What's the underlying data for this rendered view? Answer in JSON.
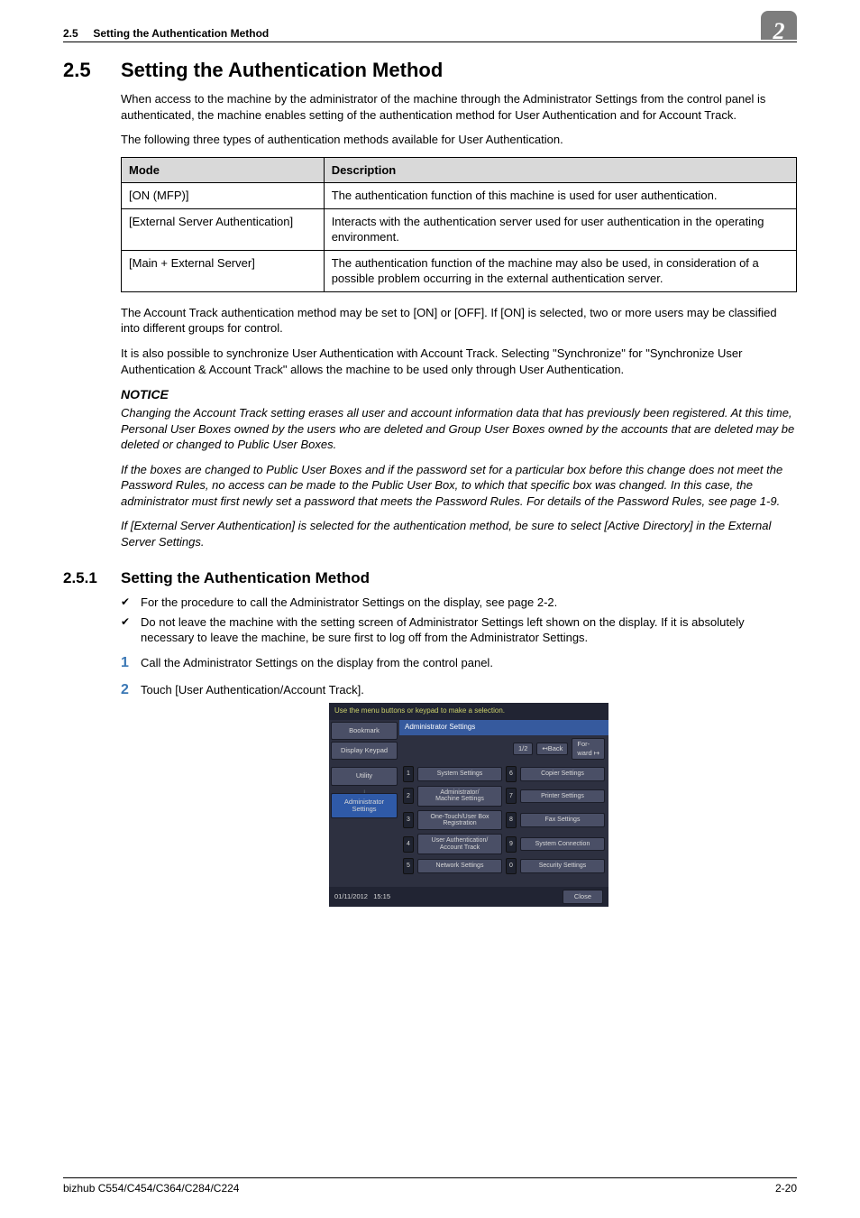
{
  "chapter_number": "2",
  "running_head": {
    "section_no": "2.5",
    "title": "Setting the Authentication Method"
  },
  "h1": {
    "number": "2.5",
    "title": "Setting the Authentication Method"
  },
  "intro": {
    "p1": "When access to the machine by the administrator of the machine through the Administrator Settings from the control panel is authenticated, the machine enables setting of the authentication method for User Authentication and for Account Track.",
    "p2": "The following three types of authentication methods available for User Authentication."
  },
  "table": {
    "head": {
      "c1": "Mode",
      "c2": "Description"
    },
    "rows": [
      {
        "c1": "[ON (MFP)]",
        "c2": "The authentication function of this machine is used for user authentication."
      },
      {
        "c1": "[External Server Authentication]",
        "c2": "Interacts with the authentication server used for user authentication in the operating environment."
      },
      {
        "c1": "[Main + External Server]",
        "c2": "The authentication function of the machine may also be used, in consideration of a possible problem occurring in the external authentication server."
      }
    ]
  },
  "after_table": {
    "p1": "The Account Track authentication method may be set to [ON] or [OFF]. If [ON] is selected, two or more users may be classified into different groups for control.",
    "p2": "It is also possible to synchronize User Authentication with Account Track. Selecting \"Synchronize\" for \"Synchronize User Authentication & Account Track\" allows the machine to be used only through User Authentication."
  },
  "notice": {
    "label": "NOTICE",
    "p1": "Changing the Account Track setting erases all user and account information data that has previously been registered. At this time, Personal User Boxes owned by the users who are deleted and Group User Boxes owned by the accounts that are deleted may be deleted or changed to Public User Boxes.",
    "p2": "If the boxes are changed to Public User Boxes and if the password set for a particular box before this change does not meet the Password Rules, no access can be made to the Public User Box, to which that specific box was changed. In this case, the administrator must first newly set a password that meets the Password Rules. For details of the Password Rules, see page 1-9.",
    "p3": "If [External Server Authentication] is selected for the authentication method, be sure to select [Active Directory] in the External Server Settings."
  },
  "h2": {
    "number": "2.5.1",
    "title": "Setting the Authentication Method"
  },
  "checks": {
    "i1": "For the procedure to call the Administrator Settings on the display, see page 2-2.",
    "i2": "Do not leave the machine with the setting screen of Administrator Settings left shown on the display. If it is absolutely necessary to leave the machine, be sure first to log off from the Administrator Settings."
  },
  "steps": {
    "s1": "Call the Administrator Settings on the display from the control panel.",
    "s2": "Touch [User Authentication/Account Track]."
  },
  "mfp": {
    "hint": "Use the menu buttons or keypad to make a selection.",
    "side": {
      "bookmark": "Bookmark",
      "keypad": "Display Keypad",
      "utility": "Utility",
      "admin": "Administrator Settings"
    },
    "title": "Administrator Settings",
    "pager": {
      "page": "1/2",
      "back": "↤Back",
      "fwd": "For-\nward ↦"
    },
    "menu": {
      "n1": "1",
      "b1": "System Settings",
      "n6": "6",
      "b6": "Copier Settings",
      "n2": "2",
      "b2": "Administrator/\nMachine Settings",
      "n7": "7",
      "b7": "Printer Settings",
      "n3": "3",
      "b3": "One-Touch/User Box\nRegistration",
      "n8": "8",
      "b8": "Fax Settings",
      "n4": "4",
      "b4": "User Authentication/\nAccount Track",
      "n9": "9",
      "b9": "System Connection",
      "n5": "5",
      "b5": "Network Settings",
      "n0": "0",
      "b0": "Security Settings"
    },
    "footer": {
      "date": "01/11/2012",
      "time": "15:15",
      "close": "Close"
    }
  },
  "page_footer": {
    "left": "bizhub C554/C454/C364/C284/C224",
    "right": "2-20"
  }
}
